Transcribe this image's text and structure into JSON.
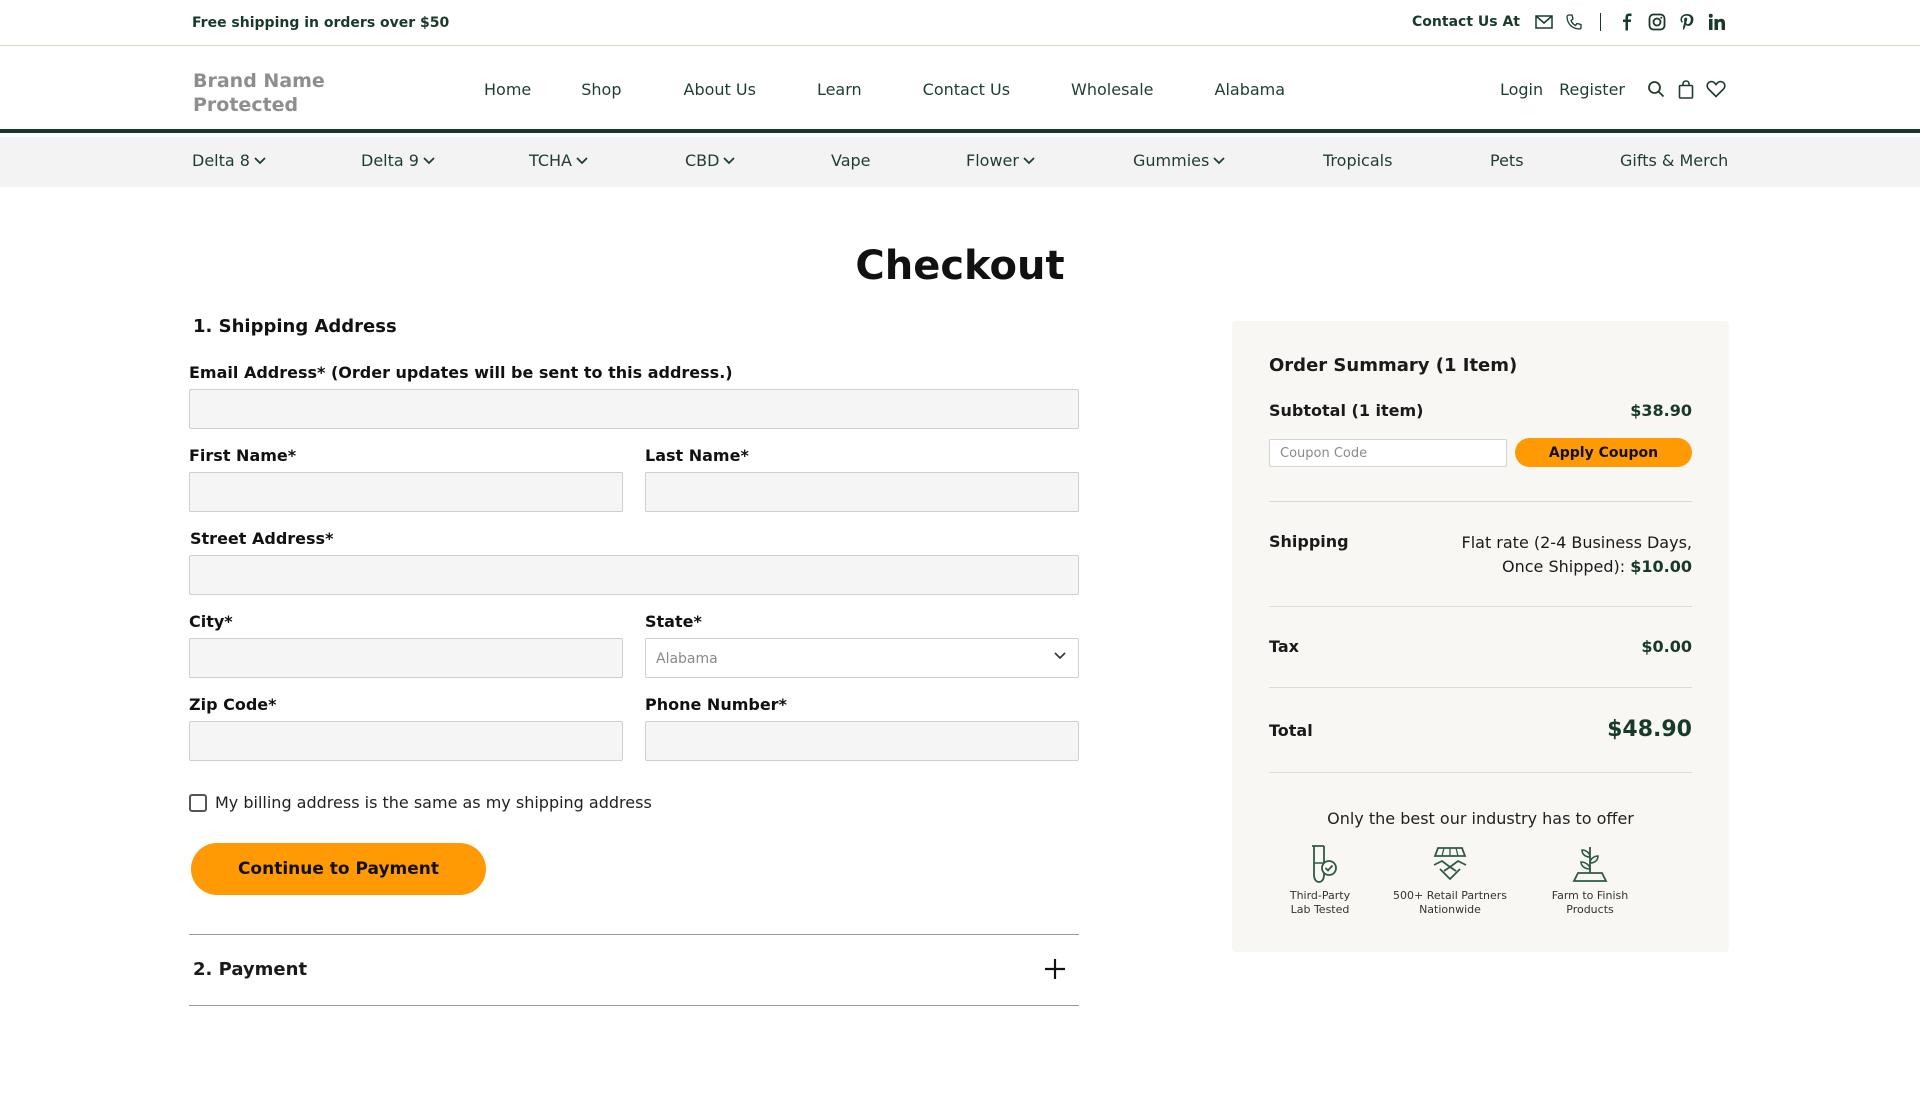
{
  "topbar": {
    "promo": "Free shipping in orders over $50",
    "contact_label": "Contact Us At",
    "icons": [
      "mail-icon",
      "phone-icon",
      "facebook-icon",
      "instagram-icon",
      "pinterest-icon",
      "linkedin-icon"
    ]
  },
  "header": {
    "brand_line1": "Brand Name",
    "brand_line2": "Protected",
    "nav": [
      "Home",
      "Shop",
      "About Us",
      "Learn",
      "Contact Us",
      "Wholesale",
      "Alabama"
    ],
    "login": "Login",
    "register": "Register",
    "icons": [
      "search-icon",
      "bag-icon",
      "heart-icon"
    ]
  },
  "categories": [
    {
      "label": "Delta 8",
      "dropdown": true
    },
    {
      "label": "Delta 9",
      "dropdown": true
    },
    {
      "label": "TCHA",
      "dropdown": true
    },
    {
      "label": "CBD",
      "dropdown": true
    },
    {
      "label": "Vape",
      "dropdown": false
    },
    {
      "label": "Flower",
      "dropdown": true
    },
    {
      "label": "Gummies",
      "dropdown": true
    },
    {
      "label": "Tropicals",
      "dropdown": false
    },
    {
      "label": "Pets",
      "dropdown": false
    },
    {
      "label": "Gifts & Merch",
      "dropdown": false
    }
  ],
  "page": {
    "title": "Checkout"
  },
  "shipping": {
    "section_title": "1. Shipping Address",
    "email_label": "Email Address* (Order updates will be sent to this address.)",
    "first_name_label": "First Name*",
    "last_name_label": "Last Name*",
    "street_label": "Street Address*",
    "city_label": "City*",
    "state_label": "State*",
    "state_value": "Alabama",
    "zip_label": "Zip Code*",
    "phone_label": "Phone Number*",
    "billing_same_label": "My billing address is the same as my shipping address",
    "continue_label": "Continue to Payment"
  },
  "payment": {
    "section_title": "2. Payment"
  },
  "summary": {
    "title": "Order Summary (1 Item)",
    "subtotal_label": "Subtotal (1 item)",
    "subtotal_value": "$38.90",
    "coupon_placeholder": "Coupon Code",
    "apply_coupon_label": "Apply Coupon",
    "shipping_label": "Shipping",
    "shipping_line1": "Flat rate (2-4 Business Days,",
    "shipping_line2": "Once Shipped):",
    "shipping_value": "$10.00",
    "tax_label": "Tax",
    "tax_value": "$0.00",
    "total_label": "Total",
    "total_value": "$48.90",
    "best_text": "Only the best our industry has to offer",
    "badges": [
      {
        "icon": "test-tube-icon",
        "line1": "Third-Party",
        "line2": "Lab Tested"
      },
      {
        "icon": "handshake-icon",
        "line1": "500+ Retail Partners",
        "line2": "Nationwide"
      },
      {
        "icon": "plant-icon",
        "line1": "Farm to Finish",
        "line2": "Products"
      }
    ]
  },
  "colors": {
    "accent": "#ff9a05",
    "brand_green": "#173a2b"
  }
}
